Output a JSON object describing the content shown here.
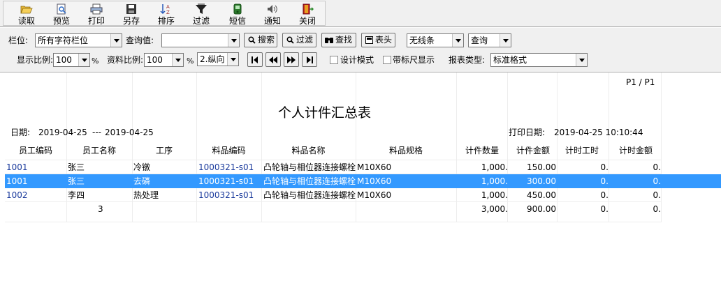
{
  "toolbar": {
    "buttons": [
      {
        "label": "读取",
        "icon": "folder-open-icon"
      },
      {
        "label": "预览",
        "icon": "preview-icon"
      },
      {
        "label": "打印",
        "icon": "printer-icon"
      },
      {
        "label": "另存",
        "icon": "save-as-icon"
      },
      {
        "label": "排序",
        "icon": "sort-icon"
      },
      {
        "label": "过滤",
        "icon": "filter-icon"
      },
      {
        "label": "短信",
        "icon": "sms-icon"
      },
      {
        "label": "通知",
        "icon": "speaker-icon"
      },
      {
        "label": "关闭",
        "icon": "exit-door-icon"
      }
    ]
  },
  "filter": {
    "field_label": "栏位:",
    "field_value": "所有字符栏位",
    "query_label": "查询值:",
    "query_value": "",
    "search_label": "搜索",
    "filter_label": "过滤",
    "find_label": "查找",
    "header_label": "表头",
    "line_style": "无线条",
    "query_mode": "查询",
    "display_ratio_label": "显示比例:",
    "display_ratio": "100",
    "percent1": "%",
    "data_ratio_label": "资料比例:",
    "data_ratio": "100",
    "percent2": "%",
    "orientation": "2.纵向",
    "design_mode_label": "设计模式",
    "ruler_label": "带标尺显示",
    "report_type_label": "报表类型:",
    "report_type": "标准格式"
  },
  "report": {
    "page": "P1 / P1",
    "title": "个人计件汇总表",
    "date_label": "日期:",
    "date_from": "2019-04-25",
    "date_sep": "---",
    "date_to": "2019-04-25",
    "print_date_label": "打印日期:",
    "print_date": "2019-04-25 10:10:44",
    "columns": [
      "员工编码",
      "员工名称",
      "工序",
      "料品编码",
      "料品名称",
      "料品规格",
      "计件数量",
      "计件金额",
      "计时工时",
      "计时金额"
    ],
    "rows": [
      {
        "emp_code": "1001",
        "emp_name": "张三",
        "process": "冷镦",
        "item_code": "1000321-s01",
        "item_name": "凸轮轴与相位器连接螺栓",
        "spec": "M10X60",
        "qty": "1,000.",
        "amount": "150.00",
        "hours": "0.",
        "time_amount": "0."
      },
      {
        "emp_code": "1001",
        "emp_name": "张三",
        "process": "去磷",
        "item_code": "1000321-s01",
        "item_name": "凸轮轴与相位器连接螺栓",
        "spec": "M10X60",
        "qty": "1,000.",
        "amount": "300.00",
        "hours": "0.",
        "time_amount": "0."
      },
      {
        "emp_code": "1002",
        "emp_name": "李四",
        "process": "热处理",
        "item_code": "1000321-s01",
        "item_name": "凸轮轴与相位器连接螺栓",
        "spec": "M10X60",
        "qty": "1,000.",
        "amount": "450.00",
        "hours": "0.",
        "time_amount": "0."
      }
    ],
    "totals": {
      "count": "3",
      "qty": "3,000.",
      "amount": "900.00",
      "hours": "0.",
      "time_amount": "0."
    }
  },
  "colors": {
    "selection": "#3399ff",
    "link": "#1a3a9c"
  }
}
